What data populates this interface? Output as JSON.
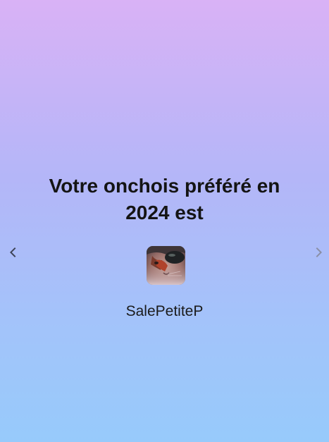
{
  "card": {
    "headline": "Votre onchois préféré en 2024 est",
    "username": "SalePetiteP"
  },
  "navigation": {
    "prev_icon": "chevron-left-icon",
    "next_icon": "chevron-right-icon",
    "prev_color": "#3c4356",
    "next_color": "#8a8fa6"
  },
  "avatar": {
    "description_icon": "cat-photo-avatar"
  },
  "colors": {
    "gradient_top": "#d9b2f6",
    "gradient_bottom": "#97cafb",
    "text": "#141414"
  }
}
